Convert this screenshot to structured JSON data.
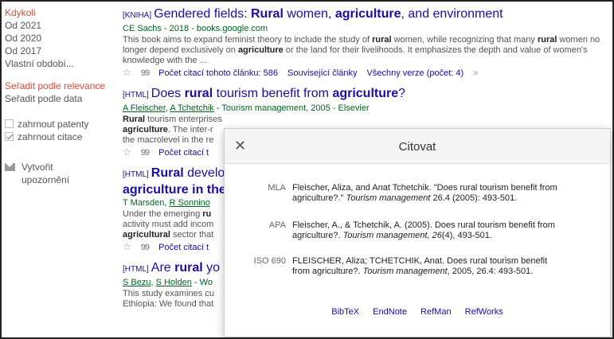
{
  "sidebar": {
    "time": [
      {
        "label": "Kdykoli",
        "active": true
      },
      {
        "label": "Od 2021",
        "active": false
      },
      {
        "label": "Od 2020",
        "active": false
      },
      {
        "label": "Od 2017",
        "active": false
      },
      {
        "label": "Vlastní období...",
        "active": false
      }
    ],
    "sort": [
      {
        "label": "Seřadit podle relevance",
        "active": true
      },
      {
        "label": "Seřadit podle data",
        "active": false
      }
    ],
    "include_patents": "zahrnout patenty",
    "include_citations": "zahrnout citace",
    "create_alert": "Vytvořit upozornění"
  },
  "results": [
    {
      "tag": "[KNIHA]",
      "title_parts": [
        "Gendered fields: ",
        "Rural",
        " women, ",
        "agriculture",
        ", and environment"
      ],
      "meta": "CE Sachs - 2018 - books.google.com",
      "snippet": [
        "This book aims to expand feminist theory to include the study of ",
        "rural",
        " women, while recognizing that many ",
        "rural",
        " women no longer depend exclusively on ",
        "agriculture",
        " or the land for their livelihoods. It emphasizes the depth and value of women's knowledge with the ..."
      ],
      "cited_by": "Počet citací tohoto článku: 586",
      "related": "Související články",
      "versions": "Všechny verze (počet: 4)"
    },
    {
      "tag": "[HTML]",
      "title_parts": [
        "Does ",
        "rural",
        " tourism benefit from ",
        "agriculture",
        "?"
      ],
      "authors": [
        "A Fleischer",
        "A Tchetchik"
      ],
      "meta_rest": " - Tourism management, 2005 - Elsevier",
      "snippet": [
        "Rural",
        " tourism enterprises have been developed in rural areas as an alternative to ",
        "agriculture",
        ". The inter-r",
        "",
        " the macrolevel in the re"
      ],
      "cited_by": "Počet citací t"
    },
    {
      "tag": "[HTML]",
      "title_parts": [
        "Rural",
        " develo"
      ],
      "title_line2": "agriculture in the",
      "authors": [
        "T Marsden",
        "R Sonnino"
      ],
      "snippet": [
        "Under the emerging ",
        "ru",
        " activity must add incom ",
        "agricultural",
        " sector that"
      ],
      "cited_by": "Počet citací t"
    },
    {
      "tag": "[HTML]",
      "title_parts": [
        "Are ",
        "rural",
        " yo"
      ],
      "authors": [
        "S Bezu",
        "S Holden"
      ],
      "meta_rest": " - Wo",
      "snippet": [
        "This study examines cu",
        " Ethiopia: We found that"
      ]
    }
  ],
  "modal": {
    "title": "Citovat",
    "citations": [
      {
        "style": "MLA",
        "pre": "Fleischer, Aliza, and Anat Tchetchik. \"Does rural tourism benefit from agriculture?.\" ",
        "journal": "Tourism management",
        "post": " 26.4 (2005): 493-501."
      },
      {
        "style": "APA",
        "pre": "Fleischer, A., & Tchetchik, A. (2005). Does rural tourism benefit from agriculture?. ",
        "journal": "Tourism management, 26",
        "post": "(4), 493-501."
      },
      {
        "style": "ISO 690",
        "pre": "FLEISCHER, Aliza; TCHETCHIK, Anat. Does rural tourism benefit from agriculture?. ",
        "journal": "Tourism management",
        "post": ", 2005, 26.4: 493-501."
      }
    ],
    "links": [
      "BibTeX",
      "EndNote",
      "RefMan",
      "RefWorks"
    ]
  }
}
